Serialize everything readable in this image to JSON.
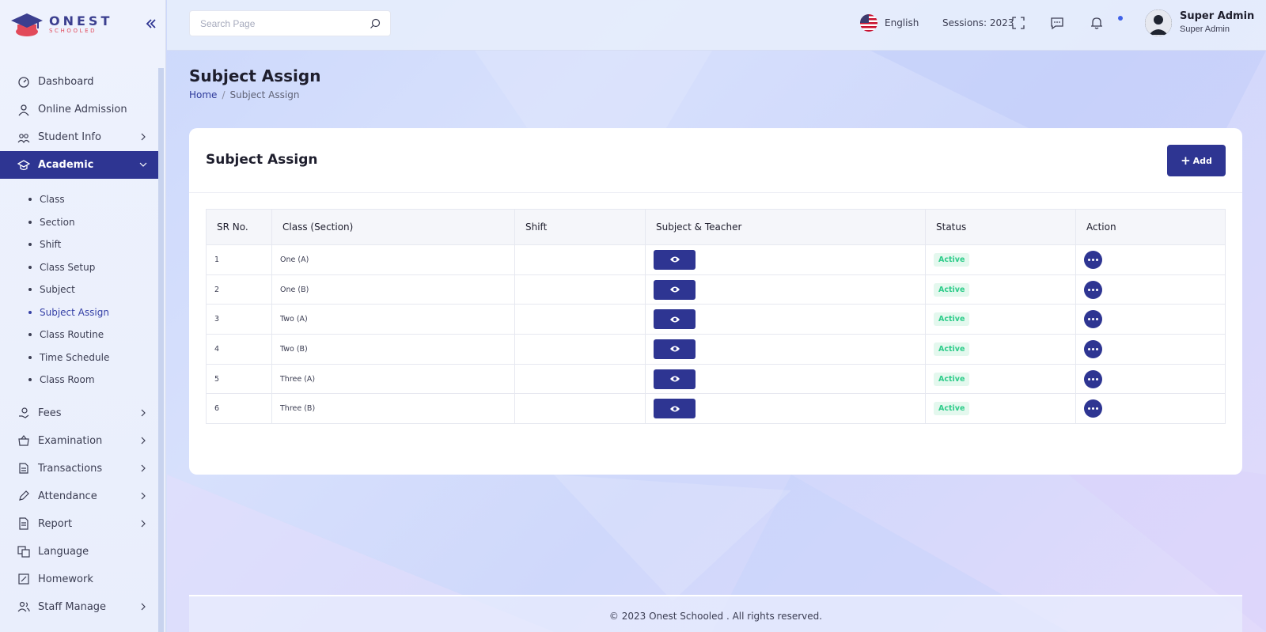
{
  "brand": {
    "title": "ONEST",
    "subtitle": "SCHOOLED"
  },
  "search": {
    "placeholder": "Search Page"
  },
  "header": {
    "language": "English",
    "session": "Sessions: 2023",
    "user_name": "Super Admin",
    "user_role": "Super Admin"
  },
  "sidebar": {
    "items_top": [
      {
        "label": "Dashboard",
        "icon": "dashboard-icon"
      },
      {
        "label": "Online Admission",
        "icon": "user-icon"
      },
      {
        "label": "Student Info",
        "icon": "students-icon"
      },
      {
        "label": "Academic",
        "icon": "academic-cap-icon"
      }
    ],
    "academic_sub": [
      "Class",
      "Section",
      "Shift",
      "Class Setup",
      "Subject",
      "Subject Assign",
      "Class Routine",
      "Time Schedule",
      "Class Room"
    ],
    "items_bottom": [
      {
        "label": "Fees",
        "icon": "fees-icon"
      },
      {
        "label": "Examination",
        "icon": "exam-icon"
      },
      {
        "label": "Transactions",
        "icon": "transactions-icon"
      },
      {
        "label": "Attendance",
        "icon": "attendance-icon"
      },
      {
        "label": "Report",
        "icon": "report-icon"
      },
      {
        "label": "Language",
        "icon": "language-icon"
      },
      {
        "label": "Homework",
        "icon": "homework-icon"
      },
      {
        "label": "Staff Manage",
        "icon": "staff-icon"
      }
    ]
  },
  "page": {
    "title": "Subject Assign",
    "breadcrumb_home": "Home",
    "breadcrumb_sep": "/",
    "breadcrumb_current": "Subject Assign"
  },
  "card": {
    "title": "Subject Assign",
    "add_plus": "+",
    "add_label": "Add",
    "columns": [
      "SR No.",
      "Class (Section)",
      "Shift",
      "Subject & Teacher",
      "Status",
      "Action"
    ],
    "rows": [
      {
        "sr": "1",
        "class_section": "One (A)",
        "shift": "",
        "status": "Active"
      },
      {
        "sr": "2",
        "class_section": "One (B)",
        "shift": "",
        "status": "Active"
      },
      {
        "sr": "3",
        "class_section": "Two (A)",
        "shift": "",
        "status": "Active"
      },
      {
        "sr": "4",
        "class_section": "Two (B)",
        "shift": "",
        "status": "Active"
      },
      {
        "sr": "5",
        "class_section": "Three (A)",
        "shift": "",
        "status": "Active"
      },
      {
        "sr": "6",
        "class_section": "Three (B)",
        "shift": "",
        "status": "Active"
      }
    ]
  },
  "footer": {
    "text": "© 2023 Onest Schooled . All rights reserved."
  },
  "colors": {
    "primary": "#2e3592",
    "active_text": "#2ecc8a",
    "active_bg": "#e4f8ee"
  }
}
